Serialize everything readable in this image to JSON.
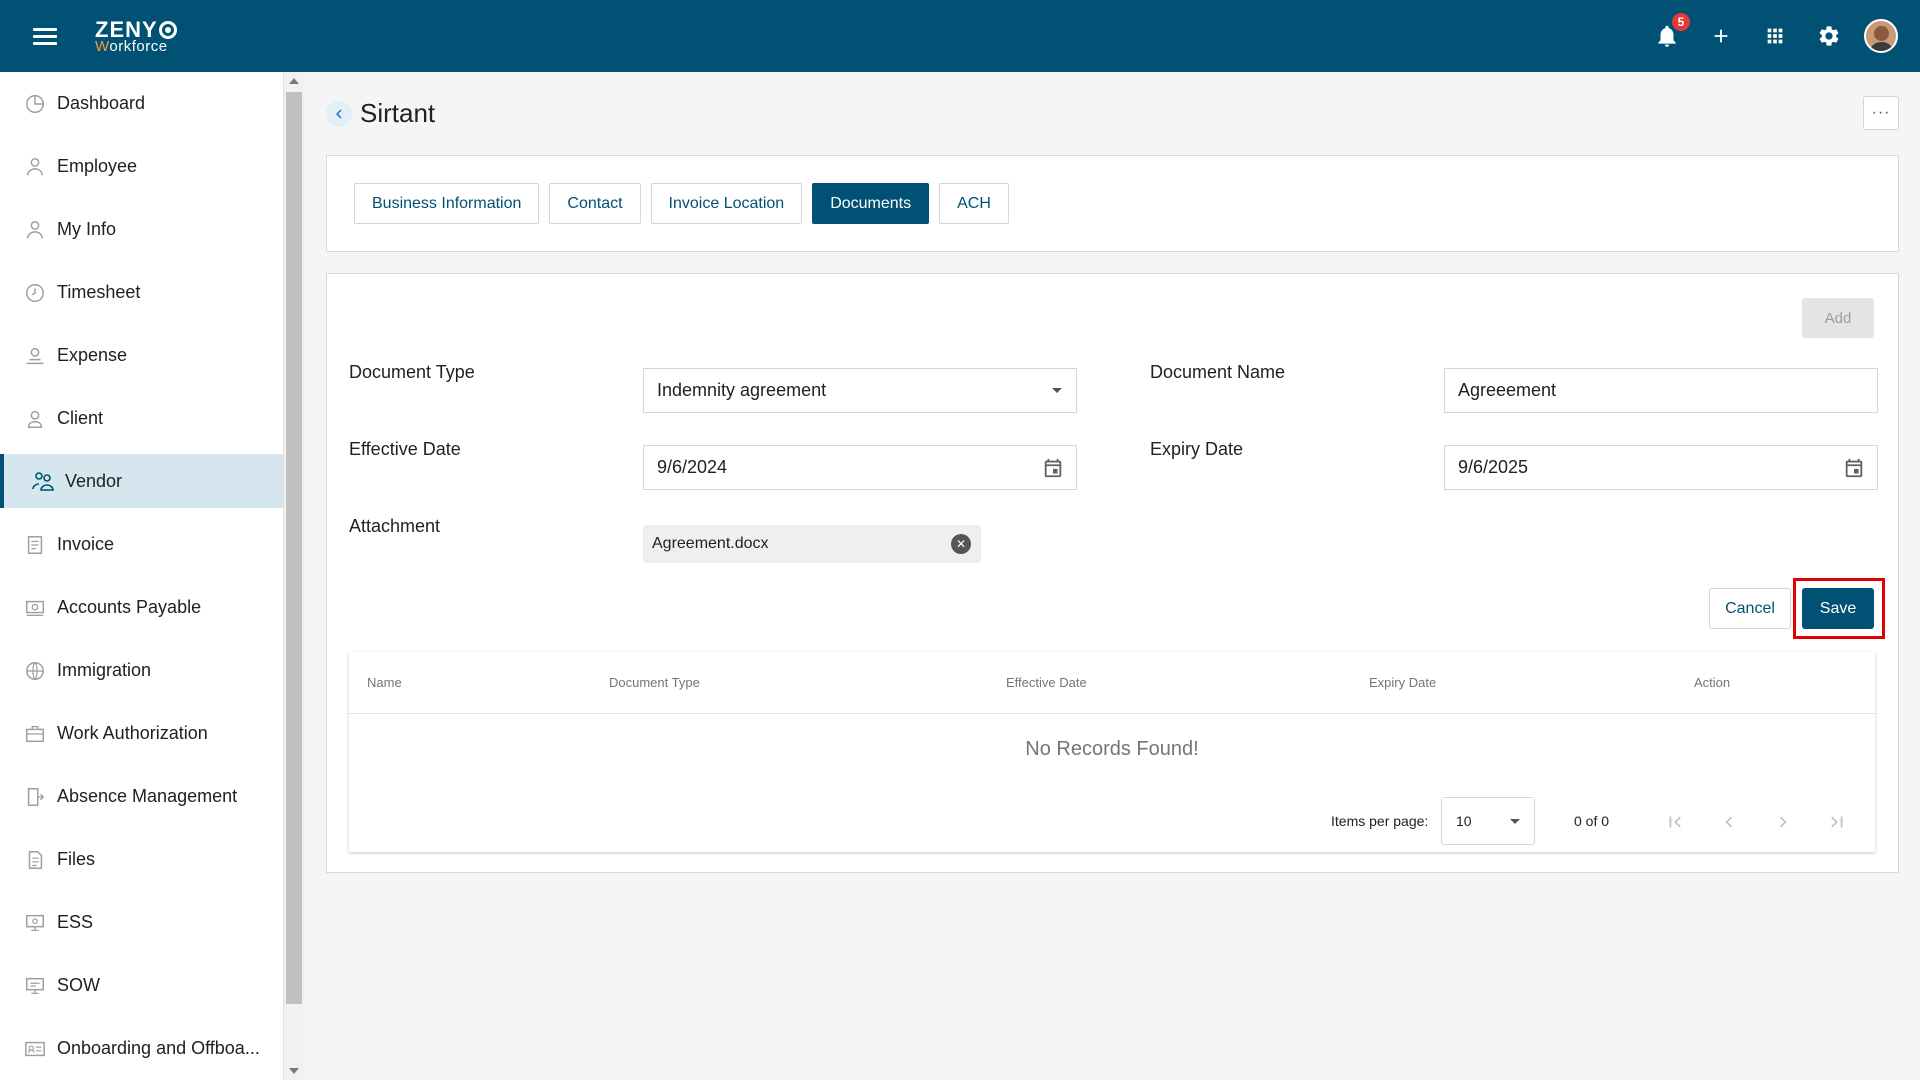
{
  "app": {
    "brand_line1": "ZENY",
    "brand_line2_accent": "W",
    "brand_line2_rest": "orkforce",
    "notification_count": "5",
    "colors": {
      "primary": "#005174",
      "badge": "#e53935",
      "highlight": "#e00000"
    }
  },
  "sidebar": {
    "items": [
      {
        "label": "Dashboard",
        "icon": "dashboard-icon"
      },
      {
        "label": "Employee",
        "icon": "employee-icon"
      },
      {
        "label": "My Info",
        "icon": "my-info-icon"
      },
      {
        "label": "Timesheet",
        "icon": "clock-icon"
      },
      {
        "label": "Expense",
        "icon": "expense-icon"
      },
      {
        "label": "Client",
        "icon": "person-icon"
      },
      {
        "label": "Vendor",
        "icon": "vendor-icon",
        "active": true
      },
      {
        "label": "Invoice",
        "icon": "invoice-icon"
      },
      {
        "label": "Accounts Payable",
        "icon": "accounts-payable-icon"
      },
      {
        "label": "Immigration",
        "icon": "globe-icon"
      },
      {
        "label": "Work Authorization",
        "icon": "briefcase-icon"
      },
      {
        "label": "Absence Management",
        "icon": "exit-door-icon"
      },
      {
        "label": "Files",
        "icon": "file-icon"
      },
      {
        "label": "ESS",
        "icon": "ess-icon"
      },
      {
        "label": "SOW",
        "icon": "sow-icon"
      },
      {
        "label": "Onboarding and Offboa...",
        "icon": "id-card-icon"
      }
    ]
  },
  "page": {
    "title": "Sirtant",
    "more_label": "···"
  },
  "tabs": [
    {
      "label": "Business Information"
    },
    {
      "label": "Contact"
    },
    {
      "label": "Invoice Location"
    },
    {
      "label": "Documents",
      "active": true
    },
    {
      "label": "ACH"
    }
  ],
  "form": {
    "add_label": "Add",
    "document_type_label": "Document Type",
    "document_type_value": "Indemnity agreement",
    "document_name_label": "Document Name",
    "document_name_value": "Agreeement",
    "effective_date_label": "Effective Date",
    "effective_date_value": "9/6/2024",
    "expiry_date_label": "Expiry Date",
    "expiry_date_value": "9/6/2025",
    "attachment_label": "Attachment",
    "attachment_file": "Agreement.docx",
    "cancel_label": "Cancel",
    "save_label": "Save"
  },
  "table": {
    "columns": [
      "Name",
      "Document Type",
      "Effective Date",
      "Expiry Date",
      "Action"
    ],
    "empty_text": "No Records Found!",
    "items_per_page_label": "Items per page:",
    "items_per_page_value": "10",
    "range_text": "0 of 0"
  }
}
